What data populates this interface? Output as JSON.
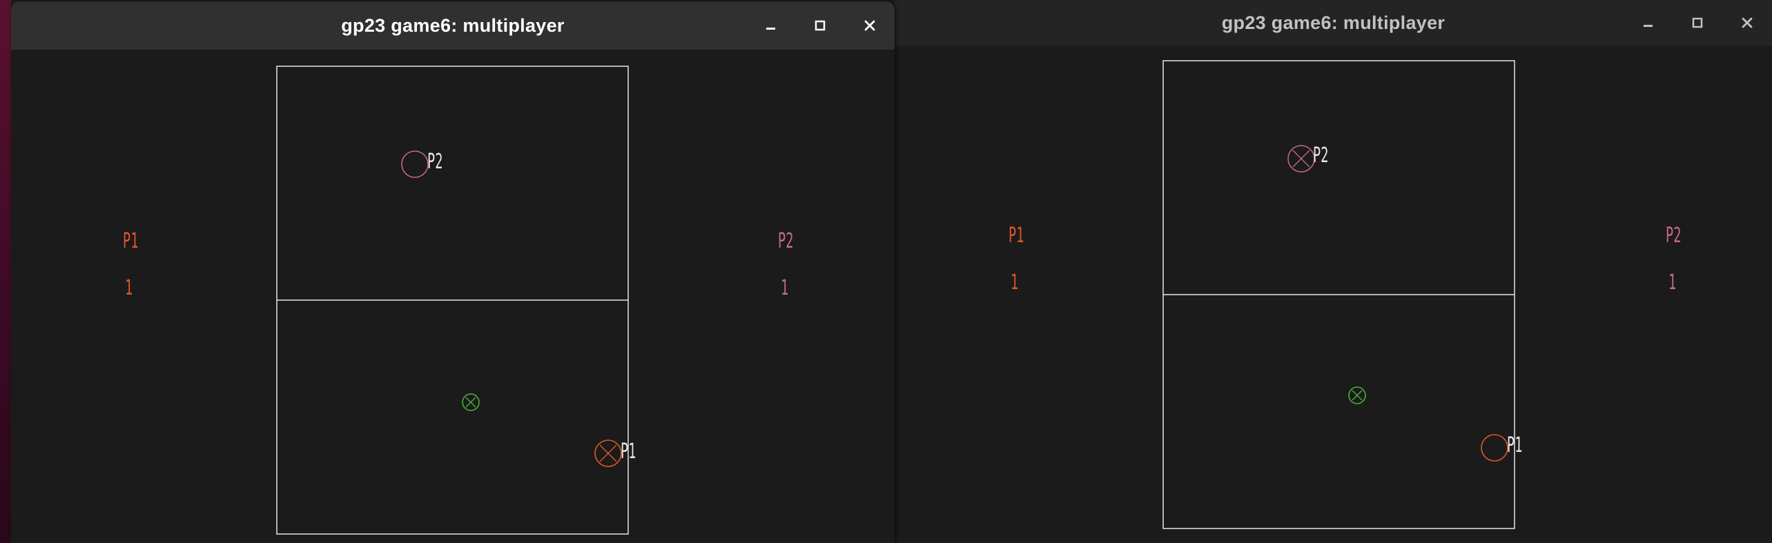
{
  "windows": [
    {
      "title": "gp23 game6: multiplayer",
      "focused": true,
      "scoreboard": {
        "p1": {
          "label": "P1",
          "score": "1"
        },
        "p2": {
          "label": "P2",
          "score": "1"
        }
      },
      "players": [
        {
          "tag": "P2",
          "marker": "circle-icon"
        },
        {
          "tag": "P1",
          "marker": "circle-cross-icon"
        }
      ],
      "target": {
        "marker": "green-circle-cross-icon"
      }
    },
    {
      "title": "gp23 game6: multiplayer",
      "focused": false,
      "scoreboard": {
        "p1": {
          "label": "P1",
          "score": "1"
        },
        "p2": {
          "label": "P2",
          "score": "1"
        }
      },
      "players": [
        {
          "tag": "P2",
          "marker": "circle-cross-icon"
        },
        {
          "tag": "P1",
          "marker": "circle-icon"
        }
      ],
      "target": {
        "marker": "green-circle-cross-icon"
      }
    }
  ],
  "colors": {
    "p1": "#e4572a",
    "p2": "#c66b89",
    "target": "#4caf3a",
    "court_lines": "#e8e8e8",
    "background": "#1b1b1b"
  }
}
